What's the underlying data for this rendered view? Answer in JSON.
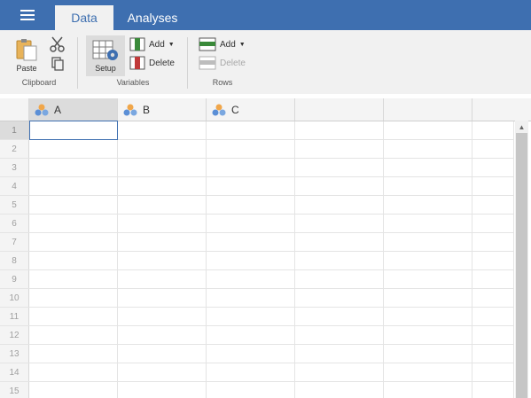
{
  "tabs": [
    {
      "label": "Data",
      "active": true
    },
    {
      "label": "Analyses",
      "active": false
    }
  ],
  "ribbon": {
    "clipboard": {
      "group_label": "Clipboard",
      "paste_label": "Paste"
    },
    "variables": {
      "group_label": "Variables",
      "setup_label": "Setup",
      "add_label": "Add",
      "delete_label": "Delete"
    },
    "rows": {
      "group_label": "Rows",
      "add_label": "Add",
      "delete_label": "Delete"
    }
  },
  "columns": [
    "A",
    "B",
    "C"
  ],
  "row_numbers": [
    "1",
    "2",
    "3",
    "4",
    "5",
    "6",
    "7",
    "8",
    "9",
    "10",
    "11",
    "12",
    "13",
    "14",
    "15"
  ],
  "colors": {
    "accent": "#3e6fb0",
    "ribbon_bg": "#f1f1f1"
  }
}
